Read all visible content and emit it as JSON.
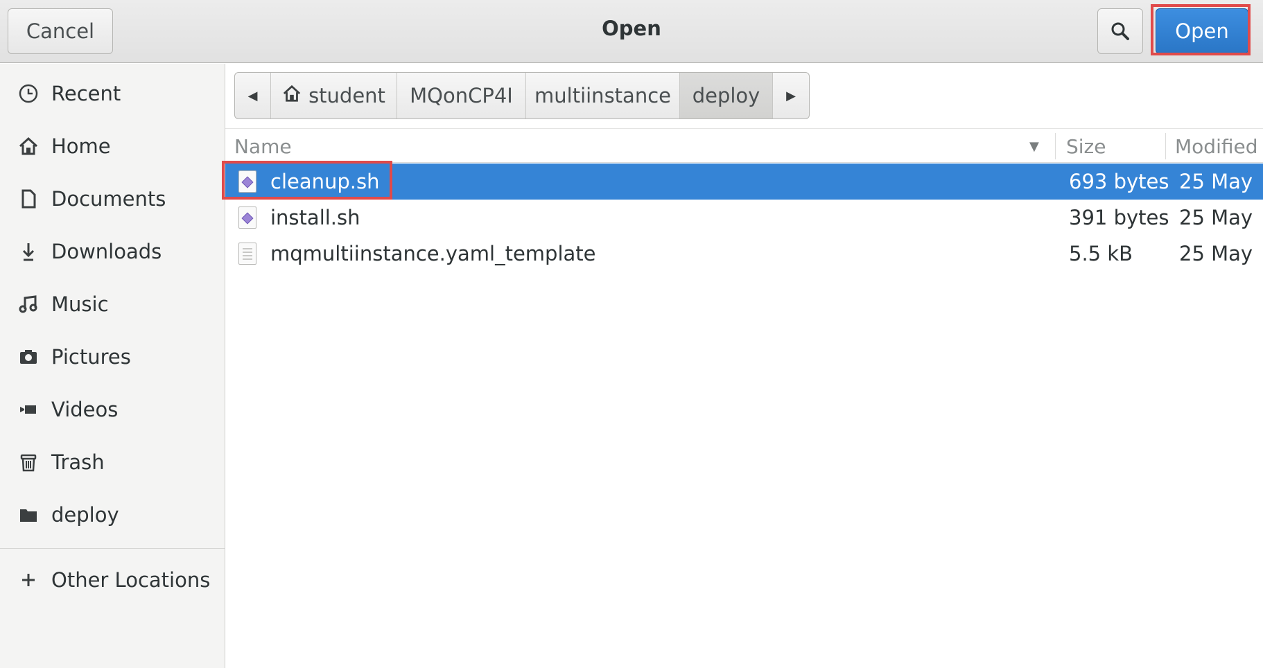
{
  "header": {
    "title": "Open",
    "cancel_label": "Cancel",
    "open_label": "Open",
    "search_icon": "search-icon"
  },
  "sidebar": {
    "items": [
      {
        "label": "Recent",
        "icon": "clock-icon"
      },
      {
        "label": "Home",
        "icon": "home-icon"
      },
      {
        "label": "Documents",
        "icon": "document-icon"
      },
      {
        "label": "Downloads",
        "icon": "download-icon"
      },
      {
        "label": "Music",
        "icon": "music-icon"
      },
      {
        "label": "Pictures",
        "icon": "camera-icon"
      },
      {
        "label": "Videos",
        "icon": "video-icon"
      },
      {
        "label": "Trash",
        "icon": "trash-icon"
      },
      {
        "label": "deploy",
        "icon": "folder-icon"
      },
      {
        "label": "Other Locations",
        "icon": "plus-icon"
      }
    ]
  },
  "pathbar": {
    "crumbs": [
      "student",
      "MQonCP4I",
      "multiinstance",
      "deploy"
    ],
    "active": "deploy"
  },
  "file_list": {
    "columns": {
      "name": "Name",
      "size": "Size",
      "modified": "Modified"
    },
    "rows": [
      {
        "name": "cleanup.sh",
        "size": "693 bytes",
        "modified": "25 May",
        "type": "script",
        "selected": true
      },
      {
        "name": "install.sh",
        "size": "391 bytes",
        "modified": "25 May",
        "type": "script",
        "selected": false
      },
      {
        "name": "mqmultiinstance.yaml_template",
        "size": "5.5 kB",
        "modified": "25 May",
        "type": "text",
        "selected": false
      }
    ]
  },
  "colors": {
    "selection": "#3584d6",
    "open_button": "#2a76c6",
    "highlight_box": "#e04a4a"
  }
}
